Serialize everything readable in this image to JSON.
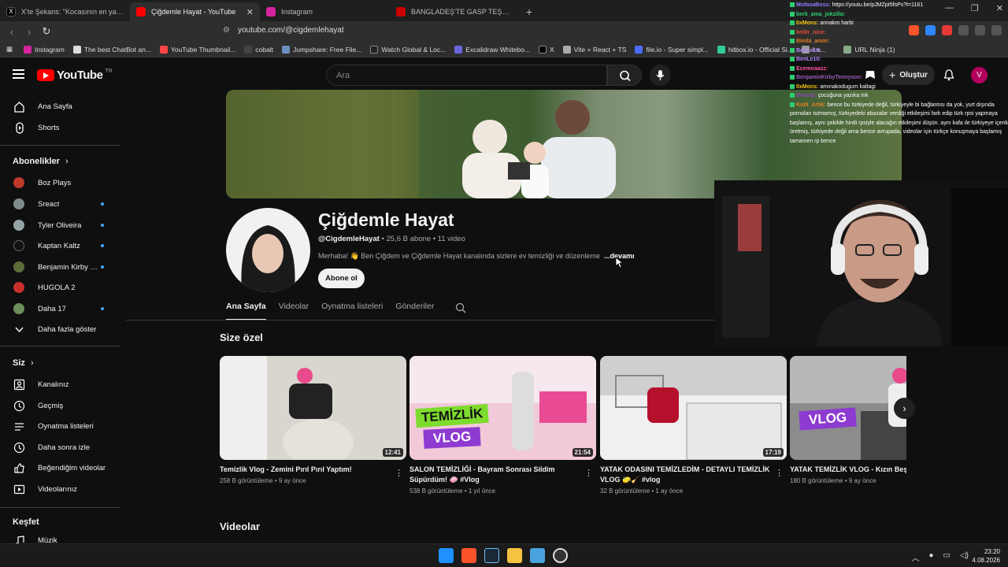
{
  "browser": {
    "tabs": [
      {
        "label": "X'te Şekans: \"Kocasının en yakın arka",
        "color": "#111111",
        "active": false
      },
      {
        "label": "Çiğdemle Hayat - YouTube",
        "color": "#ff0000",
        "active": true
      },
      {
        "label": "Instagram",
        "color": "#d6249f",
        "active": false
      },
      {
        "label": "BANGLADEŞ'TE GASP TEŞEBBÜSÜ: Al",
        "color": "#cc0000",
        "active": false
      }
    ],
    "url": "youtube.com/@cigdemlehayat",
    "bookmarks": [
      "Instagram",
      "The best ChatBot an...",
      "YouTube Thumbnail...",
      "cobalt",
      "Jumpshare: Free File...",
      "Watch Global & Loc...",
      "Excalidraw Whitebo...",
      "X",
      "Vite + React + TS",
      "file.io - Super simpl...",
      "hitbox.io - Official Si...",
      "La...",
      "URL Ninja (1)"
    ]
  },
  "youtube": {
    "logo": "YouTube",
    "region": "TR",
    "search_placeholder": "Ara",
    "create_label": "Oluştur",
    "avatar_letter": "V",
    "sidebar": {
      "main": [
        {
          "label": "Ana Sayfa",
          "icon": "home-icon"
        },
        {
          "label": "Shorts",
          "icon": "shorts-icon"
        }
      ],
      "subs_header": "Abonelikler",
      "subs": [
        {
          "label": "Boz Plays",
          "color": "#c0392b",
          "dot": false
        },
        {
          "label": "Sreact",
          "color": "#7f8c8d",
          "dot": true
        },
        {
          "label": "Tyler Oliveira",
          "color": "#95a5a6",
          "dot": true
        },
        {
          "label": "Kaptan Kaltz",
          "color": "#111111",
          "dot": true
        },
        {
          "label": "Benjamin Kirby T...",
          "color": "#5d6d3a",
          "dot": true
        },
        {
          "label": "HUGOLA 2",
          "color": "#c8302c",
          "dot": false
        },
        {
          "label": "Daha 17",
          "color": "#6b8e5a",
          "dot": true
        },
        {
          "label": "Daha fazla göster",
          "color": "",
          "dot": false
        }
      ],
      "you_header": "Siz",
      "you": [
        {
          "label": "Kanalınız",
          "icon": "channel-icon"
        },
        {
          "label": "Geçmiş",
          "icon": "history-icon"
        },
        {
          "label": "Oynatma listeleri",
          "icon": "playlist-icon"
        },
        {
          "label": "Daha sonra izle",
          "icon": "clock-icon"
        },
        {
          "label": "Beğendiğim videolar",
          "icon": "like-icon"
        },
        {
          "label": "Videolarınız",
          "icon": "video-icon"
        }
      ],
      "explore_header": "Keşfet",
      "explore": [
        {
          "label": "Müzik",
          "icon": "music-icon"
        }
      ]
    },
    "channel": {
      "name": "Çiğdemle Hayat",
      "handle": "@CigdemleHayat",
      "subscribers": "25,6 B abone",
      "video_count": "11 video",
      "description": "Merhaba! 👋 Ben Çiğdem ve Çiğdemle Hayat kanalında sizlere ev temizliği ve düzenleme",
      "more": "...devamı",
      "subscribe_label": "Abone ol",
      "tabs": [
        "Ana Sayfa",
        "Videolar",
        "Oynatma listeleri",
        "Gönderiler"
      ],
      "section_foryou": "Size özel",
      "section_videos": "Videolar",
      "videos": [
        {
          "title": "Temizlik Vlog - Zemini Pırıl Pırıl Yaptım!",
          "meta": "258 B görüntüleme • 9 ay önce",
          "duration": "12:41",
          "bg": "#d9d5cf",
          "badge": ""
        },
        {
          "title": "SALON TEMİZLİĞİ - Bayram Sonrası Sildim Süpürdüm! 🧼 #Vlog",
          "meta": "538 B görüntüleme • 1 yıl önce",
          "duration": "21:54",
          "bg": "#f2c9d9",
          "badge": "TEMİZLİK VLOG"
        },
        {
          "title": "YATAK ODASINI TEMİZLEDİM - DETAYLI TEMİZLİK VLOG 🧽🧹 #vlog",
          "meta": "32 B görüntüleme • 1 ay önce",
          "duration": "17:19",
          "bg": "#cfcfcf",
          "badge": ""
        },
        {
          "title": "YATAK TEMİZLİK VLOG - Kızın Beşiği Temizledim!",
          "meta": "180 B görüntüleme • 9 ay önce",
          "duration": "",
          "bg": "#8c8c8c",
          "badge": "VLOG"
        }
      ]
    }
  },
  "chat": [
    {
      "user": "MufasaBoss:",
      "text": "https://youtu.be/pJMZpt5fsPs?t=1161",
      "color": "#8a7bff"
    },
    {
      "user": "berk_ama_jokzilla:",
      "text": "",
      "color": "#2ecc71"
    },
    {
      "user": "0xMons:",
      "text": "annakm harbi",
      "color": "#f1c40f"
    },
    {
      "user": "bnl0r_nice:",
      "text": "",
      "color": "#e74c3c"
    },
    {
      "user": "Bimbi_anon:",
      "text": "",
      "color": "#e67e22"
    },
    {
      "user": "BenLe10:",
      "text": "",
      "color": "#b388ff"
    },
    {
      "user": "BenLe10:",
      "text": "",
      "color": "#b388ff"
    },
    {
      "user": "Ecemnaazz:",
      "text": "",
      "color": "#ff4fa3"
    },
    {
      "user": "BenjaminKirbyTennyson:",
      "text": "",
      "color": "#9b59b6"
    },
    {
      "user": "0xMons:",
      "text": "amınakodugum kaltagi",
      "color": "#f1c40f"
    },
    {
      "user": "Beomji:",
      "text": "çocuğuna yazıka mk",
      "color": "#8e44ad"
    },
    {
      "user": "Kodi_Artik:",
      "text": "bence bu türkiyede değil, türkiyeyle bi bağlantısı da yok, yurt dışında pornoları tutmamış, türkiyedeki abazalar verdiği etkileşimi fark edip türk rpsi yapmaya başlamış, aynı şekilde hintli rpsiyle alacağın etkileşimi düşün. aynı kafa ile türkiyeye içerik üretmiş, türkiyede değil ama bence avrupada, videolar için türkçe konuşmaya başlamış tamamen rp bence",
      "color": "#e67e22"
    }
  ],
  "taskbar": {
    "time": "23:20",
    "date": "4.08.2026",
    "apps": [
      "start-icon",
      "brave-icon",
      "steam-icon",
      "folder-icon",
      "photos-icon",
      "obs-icon"
    ]
  }
}
